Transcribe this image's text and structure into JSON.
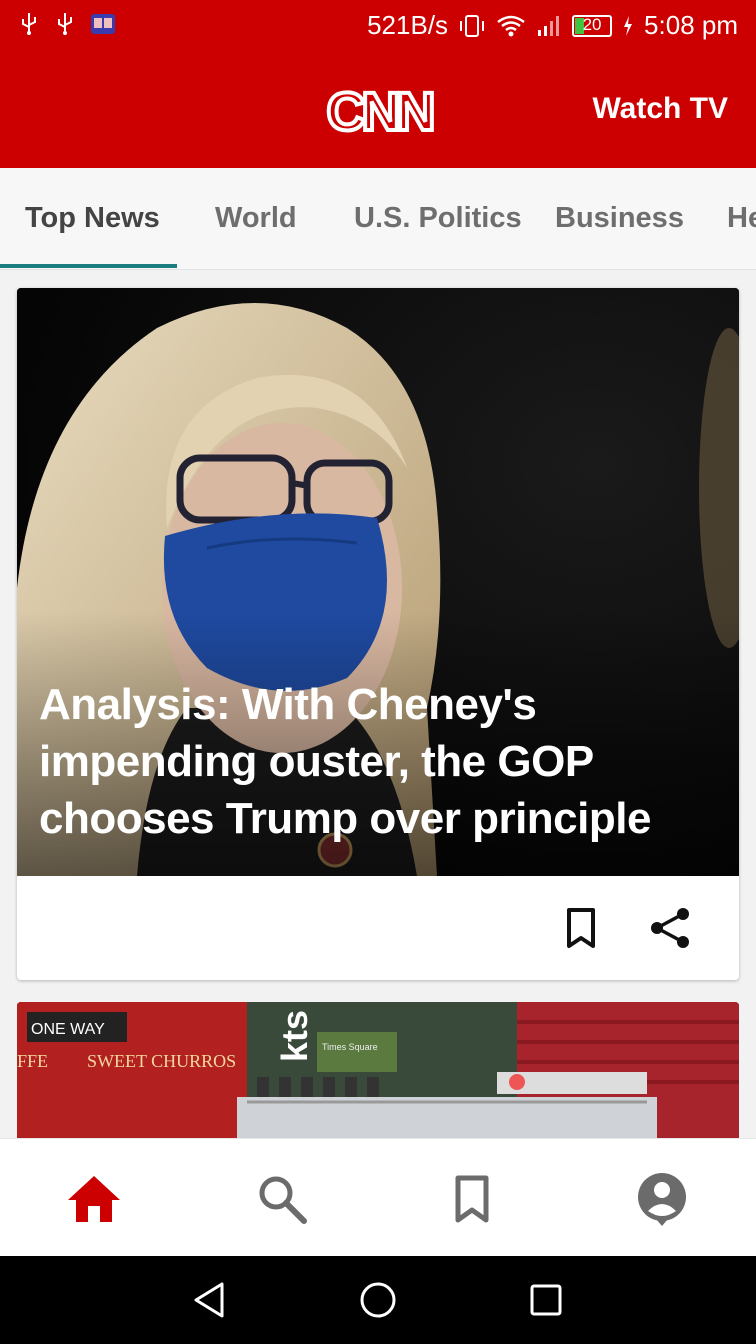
{
  "status_bar": {
    "net_speed": "521B/s",
    "battery": "20",
    "time": "5:08 pm",
    "icons": [
      "usb-icon",
      "usb-icon",
      "book-icon",
      "vibrate-icon",
      "wifi-icon",
      "signal-icon",
      "battery-icon",
      "charging-icon"
    ]
  },
  "header": {
    "logo_text": "CNN",
    "watch_tv_label": "Watch TV",
    "background_color": "#cc0000"
  },
  "tabs": [
    {
      "label": "Top News",
      "active": true
    },
    {
      "label": "World",
      "active": false
    },
    {
      "label": "U.S. Politics",
      "active": false
    },
    {
      "label": "Business",
      "active": false
    },
    {
      "label": "He",
      "active": false
    }
  ],
  "feed": {
    "lead_story": {
      "headline": "Analysis: With Cheney's impending ouster, the GOP chooses Trump over principle",
      "actions": [
        "bookmark-icon",
        "share-icon"
      ]
    },
    "second_story_image": {
      "sign_texts": [
        "ONE WAY",
        "FFE",
        "SWEET CHURROS",
        "kts",
        "Times Square"
      ]
    }
  },
  "bottom_nav": [
    {
      "name": "home",
      "icon": "home-icon",
      "active": true
    },
    {
      "name": "search",
      "icon": "search-icon",
      "active": false
    },
    {
      "name": "saved",
      "icon": "bookmark-icon",
      "active": false
    },
    {
      "name": "profile",
      "icon": "profile-icon",
      "active": false
    }
  ],
  "colors": {
    "accent": "#cc0000",
    "tab_indicator": "#1b7d7d",
    "nav_active": "#cc0000",
    "nav_inactive": "#6b6b6b"
  }
}
